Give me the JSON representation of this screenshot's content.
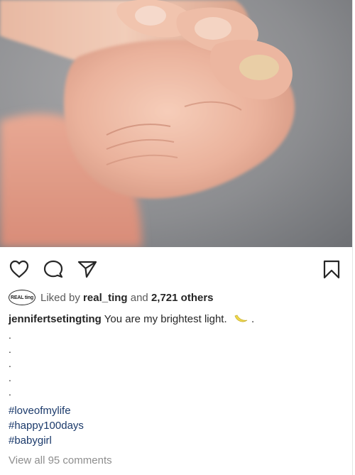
{
  "post": {
    "image": {
      "alt": "",
      "subject": "baby-hand-holding-finger"
    },
    "actions": {
      "like_icon": "heart-outline-icon",
      "comment_icon": "comment-bubble-icon",
      "share_icon": "paper-plane-icon",
      "save_icon": "bookmark-outline-icon"
    },
    "likes": {
      "avatar_text": "REAL ting",
      "prefix": "Liked by",
      "user": "real_ting",
      "connector": "and",
      "others": "2,721 others"
    },
    "caption": {
      "username": "jennifertsetingting",
      "text": "You are my brightest light.",
      "emoji": "crescent-moon-icon",
      "trailing": "."
    },
    "dots": [
      ".",
      ".",
      ".",
      ".",
      "."
    ],
    "hashtags": [
      "#loveofmylife",
      "#happy100days",
      "#babygirl"
    ],
    "comments_link": "View all 95 comments"
  },
  "colors": {
    "text": "#262626",
    "muted": "#8e8e8e",
    "hashtag": "#1b3a6b",
    "moon": "#f0d84a"
  }
}
